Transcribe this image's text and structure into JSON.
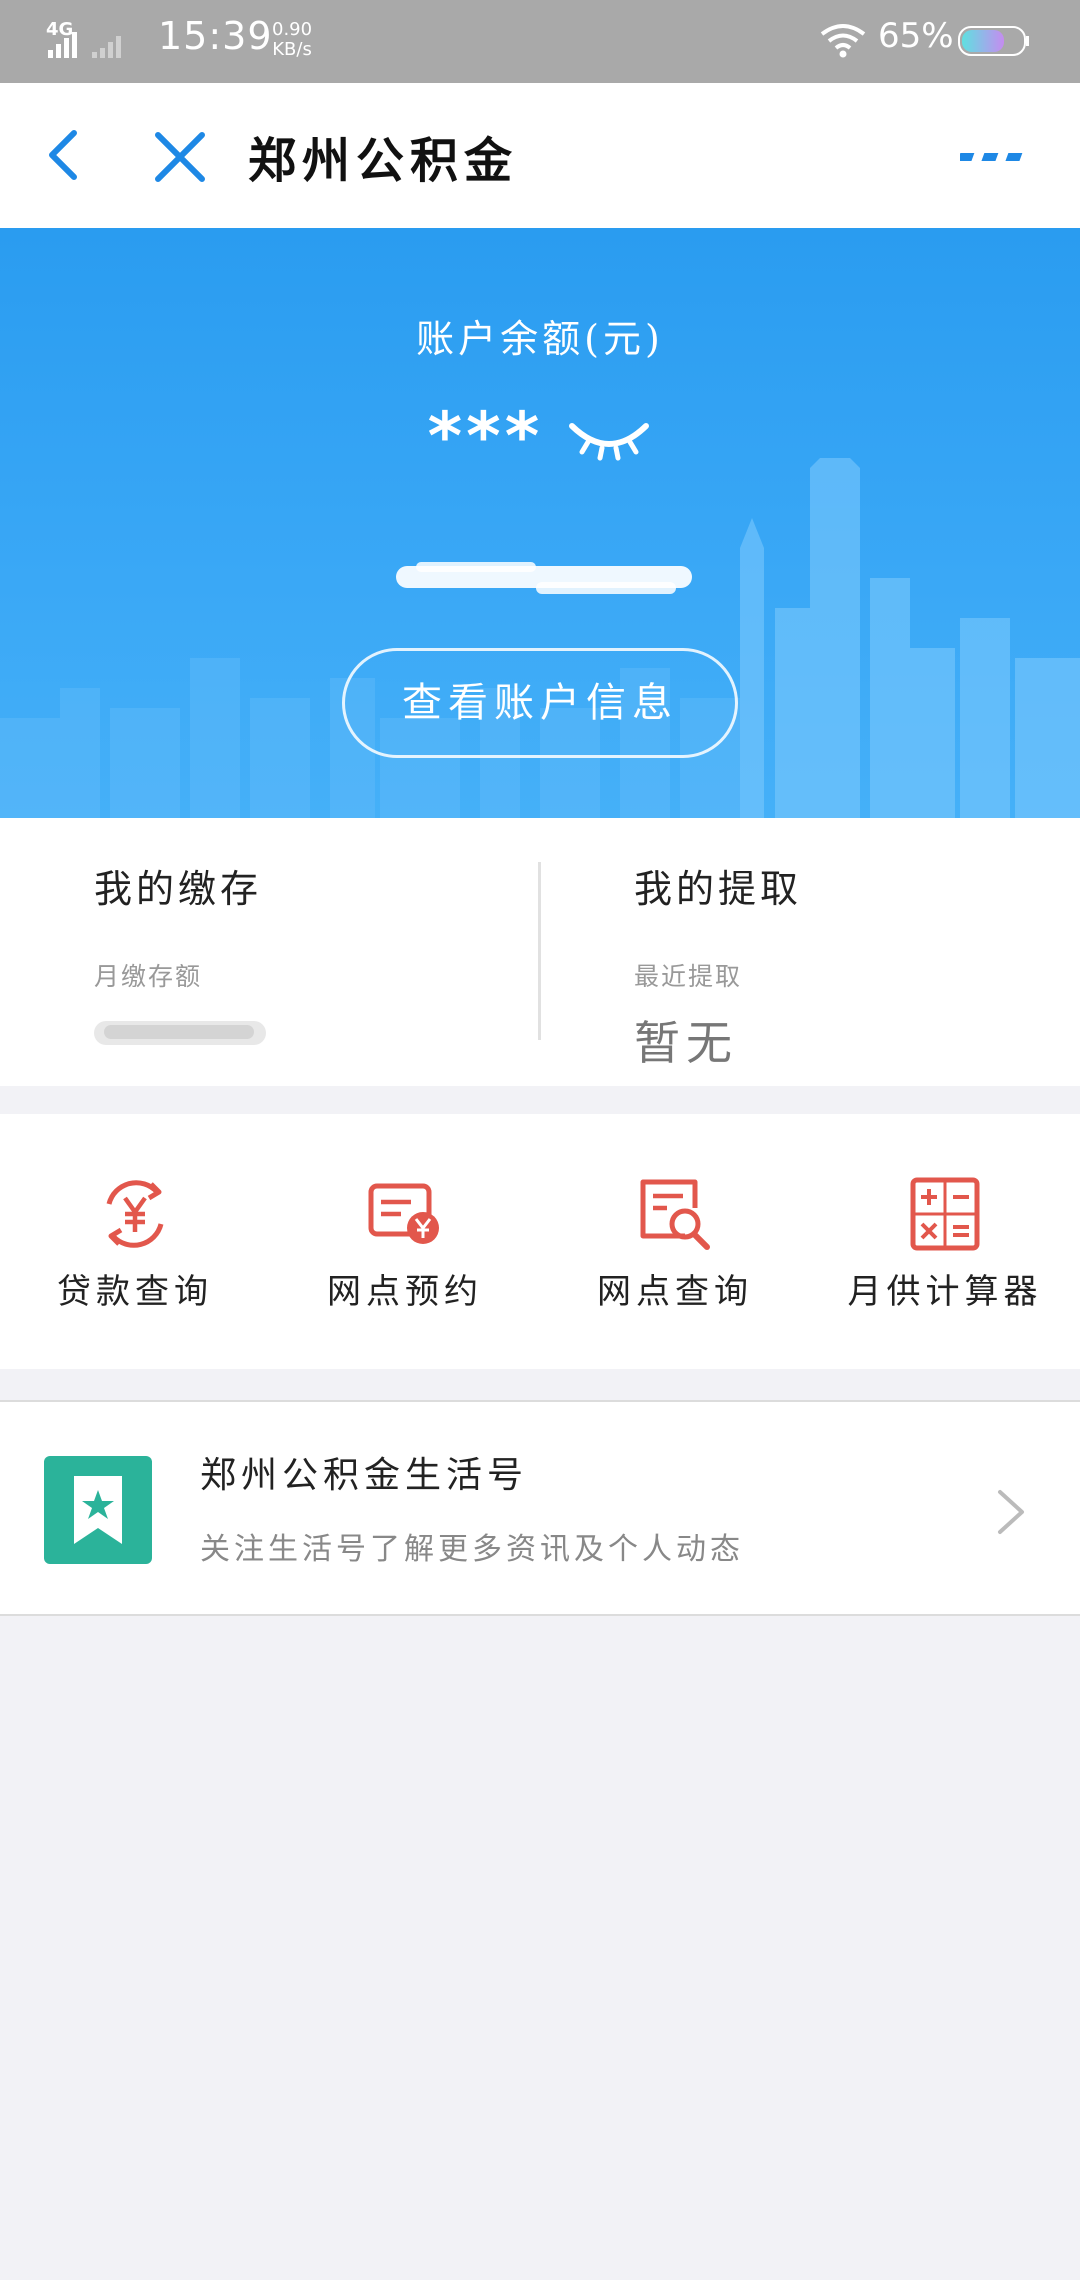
{
  "status_bar": {
    "network": "4G",
    "time": "15:39",
    "speed_value": "0.90",
    "speed_unit": "KB/s",
    "battery_pct": "65%"
  },
  "header": {
    "title": "郑州公积金",
    "icons": [
      "back-icon",
      "close-icon",
      "more-icon"
    ]
  },
  "banner": {
    "balance_label": "账户余额(元)",
    "balance_value": "***",
    "view_info_label": "查看账户信息",
    "colors": {
      "gradient_top": "#2a9cf0",
      "gradient_bottom": "#45b0f8"
    }
  },
  "summary": {
    "deposit": {
      "title": "我的缴存",
      "sub_label": "月缴存额"
    },
    "withdraw": {
      "title": "我的提取",
      "sub_label": "最近提取",
      "value": "暂无"
    }
  },
  "services": [
    {
      "label": "贷款查询",
      "icon": "loan-query-icon"
    },
    {
      "label": "网点预约",
      "icon": "outlet-booking-icon"
    },
    {
      "label": "网点查询",
      "icon": "outlet-search-icon"
    },
    {
      "label": "月供计算器",
      "icon": "calculator-icon"
    }
  ],
  "life_account": {
    "title": "郑州公积金生活号",
    "description": "关注生活号了解更多资讯及个人动态",
    "logo_color": "#2bb39a"
  },
  "accent_colors": {
    "primary_blue": "#1e88e5",
    "service_red": "#e2574c"
  }
}
